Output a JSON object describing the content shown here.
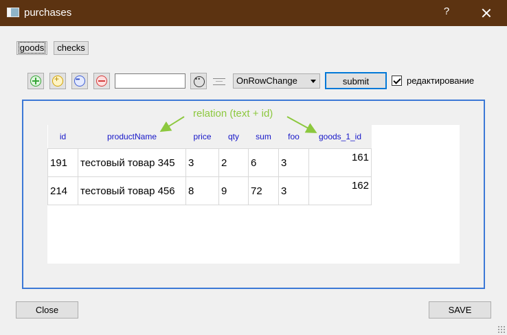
{
  "window": {
    "title": "purchases",
    "help_label": "?",
    "close_label": "close"
  },
  "tabs": [
    {
      "label": "goods",
      "active": true
    },
    {
      "label": "checks",
      "active": false
    }
  ],
  "toolbar": {
    "icons": [
      "add-circle-icon",
      "add-copy-icon",
      "more-circle-icon",
      "delete-circle-icon",
      "find-icon",
      "split-icon"
    ],
    "search_value": "",
    "mode_value": "OnRowChange",
    "submit_label": "submit",
    "edit_checked": true,
    "edit_label": "редактирование"
  },
  "annotation": {
    "text": "relation (text + id)",
    "color": "#8cc83e"
  },
  "table": {
    "columns": [
      "id",
      "productName",
      "price",
      "qty",
      "sum",
      "foo",
      "goods_1_id"
    ],
    "rows": [
      [
        "191",
        "тестовый товар 345",
        "3",
        "2",
        "6",
        "3",
        "161"
      ],
      [
        "214",
        "тестовый товар 456",
        "8",
        "9",
        "72",
        "3",
        "162"
      ]
    ]
  },
  "footer": {
    "close_label": "Close",
    "save_label": "SAVE"
  },
  "colors": {
    "titlebar": "#5c3311",
    "frame_border": "#3b78d6",
    "header_text": "#1515c8"
  }
}
